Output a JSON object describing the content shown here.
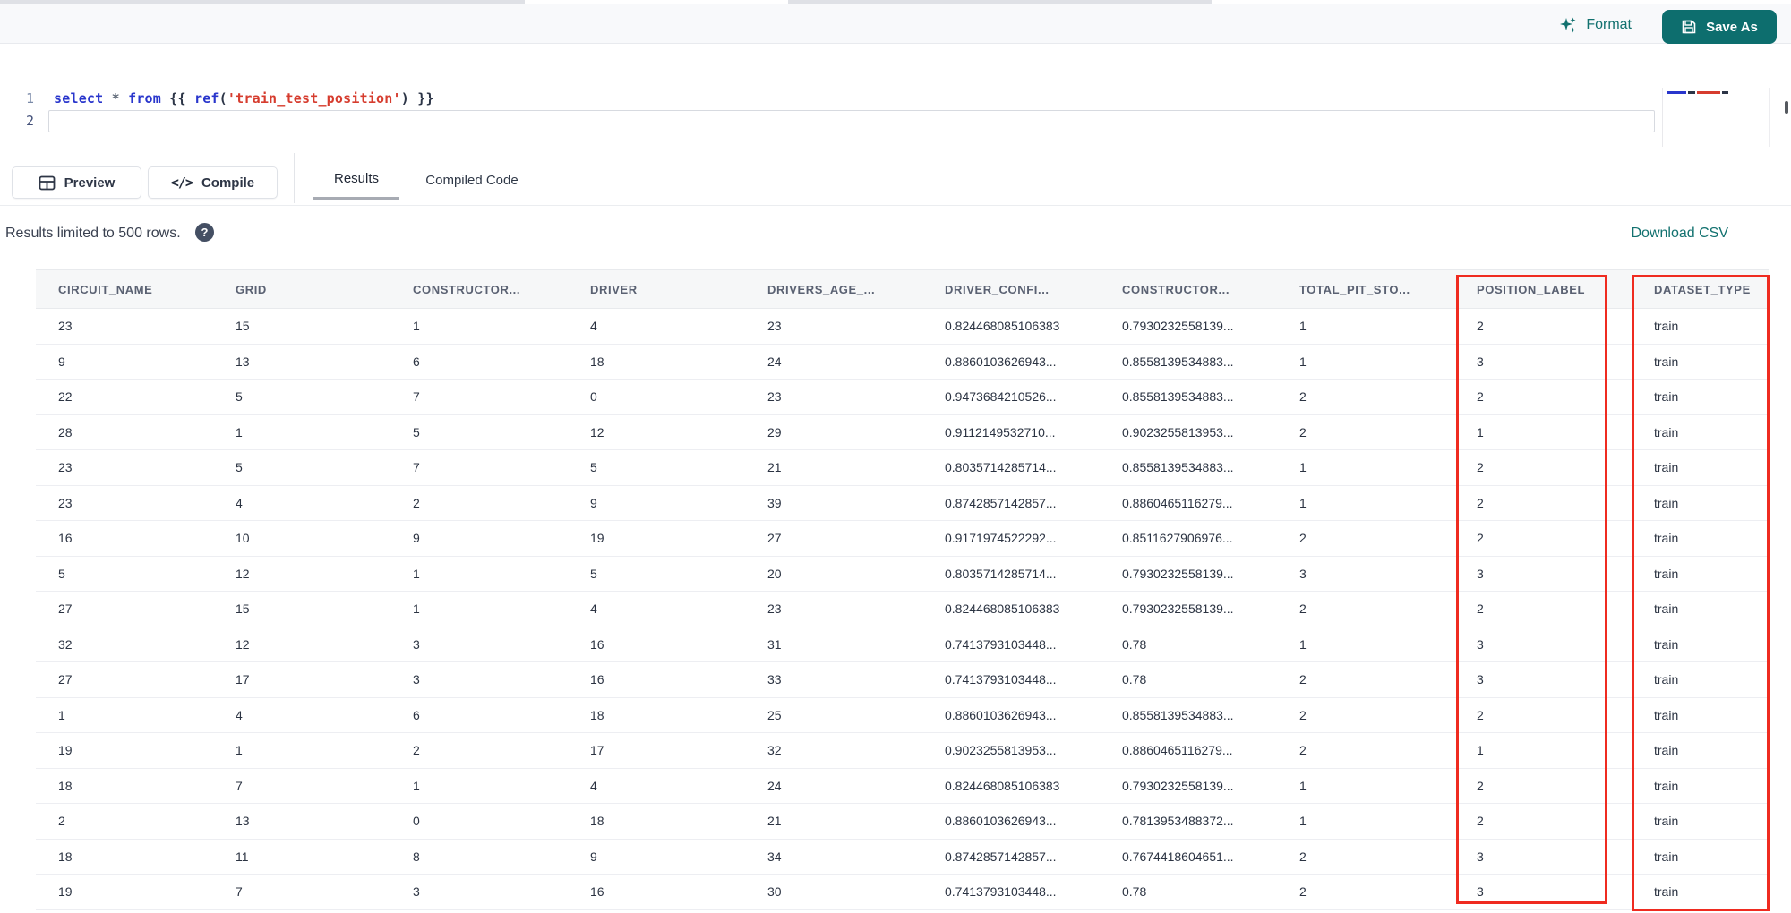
{
  "toolbar": {
    "format_label": "Format",
    "save_as_label": "Save As"
  },
  "editor": {
    "line_numbers": [
      "1",
      "2"
    ],
    "syntax_colors": {
      "keyword": "#2936cc",
      "operator": "#5c6675",
      "brace": "#2c3547",
      "function": "#2936cc",
      "string": "#d63c2e"
    },
    "code_tokens": [
      {
        "text": "select",
        "color": "keyword"
      },
      {
        "text": " ",
        "color": "brace"
      },
      {
        "text": "*",
        "color": "operator"
      },
      {
        "text": " ",
        "color": "brace"
      },
      {
        "text": "from",
        "color": "keyword"
      },
      {
        "text": " ",
        "color": "brace"
      },
      {
        "text": "{{ ",
        "color": "brace"
      },
      {
        "text": "ref",
        "color": "function"
      },
      {
        "text": "(",
        "color": "brace"
      },
      {
        "text": "'train_test_position'",
        "color": "string"
      },
      {
        "text": ") ",
        "color": "brace"
      },
      {
        "text": "}}",
        "color": "brace"
      }
    ]
  },
  "actions": {
    "preview_label": "Preview",
    "compile_label": "Compile",
    "compile_glyph": "</>"
  },
  "tabs": {
    "results": "Results",
    "compiled_code": "Compiled Code",
    "active": "Results"
  },
  "results": {
    "limit_notice": "Results limited to 500 rows.",
    "help_glyph": "?",
    "download_label": "Download CSV"
  },
  "table": {
    "columns": [
      "CIRCUIT_NAME",
      "GRID",
      "CONSTRUCTOR...",
      "DRIVER",
      "DRIVERS_AGE_...",
      "DRIVER_CONFI...",
      "CONSTRUCTOR...",
      "TOTAL_PIT_STO...",
      "POSITION_LABEL",
      "DATASET_TYPE"
    ],
    "rows": [
      [
        "23",
        "15",
        "1",
        "4",
        "23",
        "0.824468085106383",
        "0.7930232558139...",
        "1",
        "2",
        "train"
      ],
      [
        "9",
        "13",
        "6",
        "18",
        "24",
        "0.8860103626943...",
        "0.8558139534883...",
        "1",
        "3",
        "train"
      ],
      [
        "22",
        "5",
        "7",
        "0",
        "23",
        "0.9473684210526...",
        "0.8558139534883...",
        "2",
        "2",
        "train"
      ],
      [
        "28",
        "1",
        "5",
        "12",
        "29",
        "0.9112149532710...",
        "0.9023255813953...",
        "2",
        "1",
        "train"
      ],
      [
        "23",
        "5",
        "7",
        "5",
        "21",
        "0.8035714285714...",
        "0.8558139534883...",
        "1",
        "2",
        "train"
      ],
      [
        "23",
        "4",
        "2",
        "9",
        "39",
        "0.8742857142857...",
        "0.8860465116279...",
        "1",
        "2",
        "train"
      ],
      [
        "16",
        "10",
        "9",
        "19",
        "27",
        "0.9171974522292...",
        "0.8511627906976...",
        "2",
        "2",
        "train"
      ],
      [
        "5",
        "12",
        "1",
        "5",
        "20",
        "0.8035714285714...",
        "0.7930232558139...",
        "3",
        "3",
        "train"
      ],
      [
        "27",
        "15",
        "1",
        "4",
        "23",
        "0.824468085106383",
        "0.7930232558139...",
        "2",
        "2",
        "train"
      ],
      [
        "32",
        "12",
        "3",
        "16",
        "31",
        "0.7413793103448...",
        "0.78",
        "1",
        "3",
        "train"
      ],
      [
        "27",
        "17",
        "3",
        "16",
        "33",
        "0.7413793103448...",
        "0.78",
        "2",
        "3",
        "train"
      ],
      [
        "1",
        "4",
        "6",
        "18",
        "25",
        "0.8860103626943...",
        "0.8558139534883...",
        "2",
        "2",
        "train"
      ],
      [
        "19",
        "1",
        "2",
        "17",
        "32",
        "0.9023255813953...",
        "0.8860465116279...",
        "2",
        "1",
        "train"
      ],
      [
        "18",
        "7",
        "1",
        "4",
        "24",
        "0.824468085106383",
        "0.7930232558139...",
        "1",
        "2",
        "train"
      ],
      [
        "2",
        "13",
        "0",
        "18",
        "21",
        "0.8860103626943...",
        "0.7813953488372...",
        "1",
        "2",
        "train"
      ],
      [
        "18",
        "11",
        "8",
        "9",
        "34",
        "0.8742857142857...",
        "0.7674418604651...",
        "2",
        "3",
        "train"
      ],
      [
        "19",
        "7",
        "3",
        "16",
        "30",
        "0.7413793103448...",
        "0.78",
        "2",
        "3",
        "train"
      ]
    ]
  },
  "highlight": {
    "color": "#ef2b20",
    "boxes": [
      "POSITION_LABEL",
      "DATASET_TYPE"
    ]
  },
  "colors": {
    "accent_teal": "#0d6e6e",
    "link_teal": "#12716f",
    "header_text": "#5a6172",
    "cell_text": "#2b3342"
  }
}
